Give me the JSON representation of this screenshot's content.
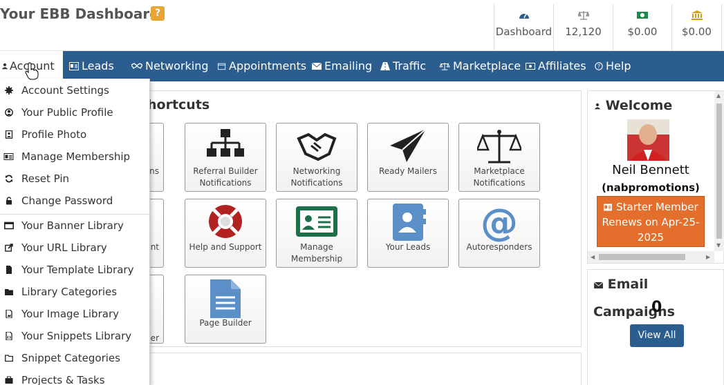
{
  "header": {
    "title": "Your EBB Dashboard",
    "help_badge": "?",
    "stats": [
      {
        "icon": "dashboard-icon",
        "label": "Dashboard"
      },
      {
        "icon": "scale-icon",
        "label": "12,120"
      },
      {
        "icon": "money-icon",
        "label": "$0.00"
      },
      {
        "icon": "bank-icon",
        "label": "$0.00"
      }
    ]
  },
  "nav": {
    "items": [
      {
        "icon": "user-icon",
        "label": "Account"
      },
      {
        "icon": "id-card-icon",
        "label": "Leads"
      },
      {
        "icon": "handshake-icon",
        "label": "Networking"
      },
      {
        "icon": "calendar-icon",
        "label": "Appointments"
      },
      {
        "icon": "envelope-icon",
        "label": "Emailing"
      },
      {
        "icon": "road-icon",
        "label": "Traffic"
      },
      {
        "icon": "scale-icon",
        "label": "Marketplace"
      },
      {
        "icon": "money-icon",
        "label": "Affiliates"
      },
      {
        "icon": "question-icon",
        "label": "Help"
      }
    ]
  },
  "account_menu": {
    "items": [
      {
        "icon": "gear-icon",
        "label": "Account Settings"
      },
      {
        "icon": "user-circle-icon",
        "label": "Your Public Profile"
      },
      {
        "icon": "photo-icon",
        "label": "Profile Photo"
      },
      {
        "icon": "id-card-icon",
        "label": "Manage Membership"
      },
      {
        "icon": "refresh-icon",
        "label": "Reset Pin"
      },
      {
        "icon": "lock-icon",
        "label": "Change Password"
      },
      {
        "icon": "window-icon",
        "label": "Your Banner Library"
      },
      {
        "icon": "external-link-icon",
        "label": "Your URL Library"
      },
      {
        "icon": "file-icon",
        "label": "Your Template Library"
      },
      {
        "icon": "folder-icon",
        "label": "Library Categories"
      },
      {
        "icon": "image-icon",
        "label": "Your Image Library"
      },
      {
        "icon": "code-file-icon",
        "label": "Your Snippets Library"
      },
      {
        "icon": "folder-open-icon",
        "label": "Snippet Categories"
      },
      {
        "icon": "tasks-icon",
        "label": "Projects & Tasks"
      }
    ]
  },
  "shortcuts": {
    "title_visible": "hortcuts",
    "tiles": [
      {
        "icon": "notifications-icon",
        "label_visible": "tions"
      },
      {
        "icon": "sitemap-icon",
        "label": "Referral Builder Notifications"
      },
      {
        "icon": "handshake-icon",
        "label": "Networking Notifications"
      },
      {
        "icon": "paper-plane-icon",
        "label": "Ready Mailers"
      },
      {
        "icon": "scale-icon",
        "label": "Marketplace Notifications"
      },
      {
        "icon": "account-icon",
        "label_visible": "nt"
      },
      {
        "icon": "lifebuoy-icon",
        "label": "Help and Support"
      },
      {
        "icon": "id-card-icon",
        "label": "Manage Membership"
      },
      {
        "icon": "contact-book-icon",
        "label": "Your Leads"
      },
      {
        "icon": "at-sign-icon",
        "label": "Autoresponders"
      },
      {
        "icon": "builder-icon",
        "label_visible": "der"
      },
      {
        "icon": "document-icon",
        "label": "Page Builder"
      }
    ]
  },
  "welcome": {
    "title": "Welcome",
    "name": "Neil Bennett",
    "username": "(nabpromotions)",
    "membership": "Starter Member Renews on Apr-25-2025"
  },
  "email_campaigns": {
    "title": "Email",
    "subtitle": "Campaigns",
    "count": "0",
    "button": "View All"
  },
  "colors": {
    "nav": "#2b5d8f",
    "accent_orange": "#e46f2c",
    "help_badge": "#e8a534"
  }
}
